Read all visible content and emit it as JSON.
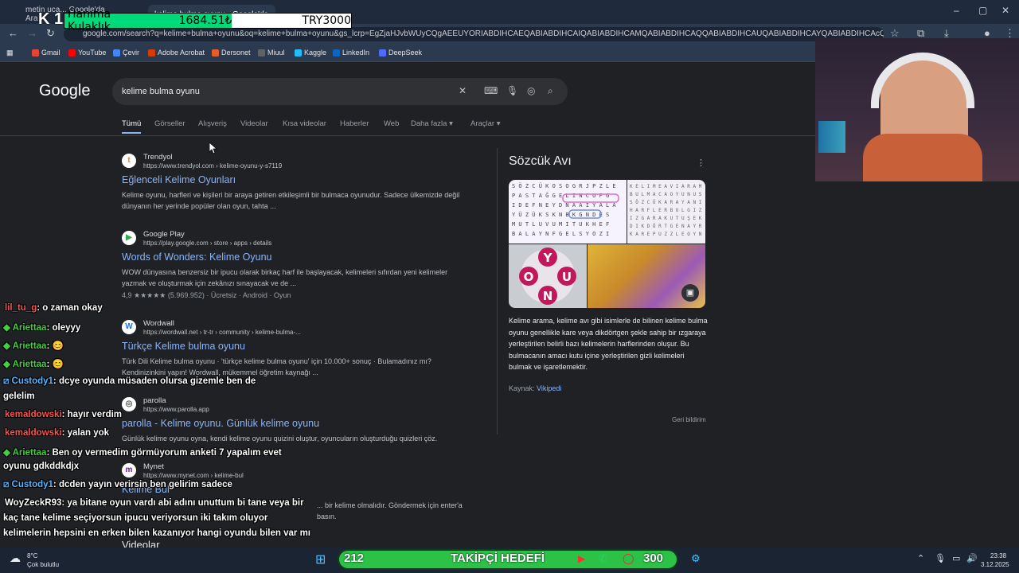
{
  "overlay": {
    "price_item": "Hanıma Kulaklık",
    "price_value": "1684.51₺",
    "price_target": "TRY3000",
    "logo_number": "12"
  },
  "browser": {
    "tabs": [
      {
        "label": "metin uca... Google'da Ara"
      },
      {
        "label": "kelime bulma oyunu - Google'da"
      }
    ],
    "url": "google.com/search?q=kelime+bulma+oyunu&oq=kelime+bulma+oyunu&gs_lcrp=EgZjaHJvbWUyCQgAEEUYORIABDIHCAEQABIABDIHCAIQABIABDIHCAMQABIABDIHCAQQABIABDIHCAUQABIABDIHCAYQABIABDIHCAcQABIABDIHCAgQABIABDIHCAkQABIABNIBCDI4ODVqMGo3qAIAsAIA",
    "bookmarks": [
      {
        "label": "Gmail",
        "color": "#ea4335"
      },
      {
        "label": "YouTube",
        "color": "#ff0000"
      },
      {
        "label": "Çevir",
        "color": "#4285f4"
      },
      {
        "label": "Adobe Acrobat",
        "color": "#d83b01"
      },
      {
        "label": "Dersonet",
        "color": "#e85c2b"
      },
      {
        "label": "Miuul",
        "color": "#5f6368"
      },
      {
        "label": "Kaggle",
        "color": "#20beff"
      },
      {
        "label": "LinkedIn",
        "color": "#0a66c2"
      },
      {
        "label": "DeepSeek",
        "color": "#4d6bfe"
      }
    ]
  },
  "google": {
    "logo": "Google",
    "query": "kelime bulma oyunu",
    "tabs": [
      "Tümü",
      "Görseller",
      "Alışveriş",
      "Videolar",
      "Kısa videolar",
      "Haberler",
      "Web",
      "Daha fazla",
      "Araçlar"
    ],
    "results": [
      {
        "site": "Trendyol",
        "url": "https://www.trendyol.com › kelime-oyunu-y-s7119",
        "title": "Eğlenceli Kelime Oyunları",
        "snippet": "Kelime oyunu, harfleri ve kişileri bir araya getiren etkileşimli bir bulmaca oyunudur. Sadece ülkemizde değil dünyanın her yerinde popüler olan oyun, tahta ..."
      },
      {
        "site": "Google Play",
        "url": "https://play.google.com › store › apps › details",
        "title": "Words of Wonders: Kelime Oyunu",
        "snippet": "WOW dünyasına benzersiz bir ipucu olarak birkaç harf ile başlayacak, kelimeleri sıfırdan yeni kelimeler yazmak ve oluşturmak için zekânızı sınayacak ve de ...",
        "meta": "4,9 ★★★★★ (5.969.952) · Ücretsiz · Android · Oyun"
      },
      {
        "site": "Wordwall",
        "url": "https://wordwall.net › tr-tr › community › kelime-bulma-...",
        "title": "Türkçe Kelime bulma oyunu",
        "snippet": "Türk Dili Kelime bulma oyunu · 'türkçe kelime bulma oyunu' için 10.000+ sonuç · Bulamadınız mı? Kendinizinkini yapın! Wordwall, mükemmel öğretim kaynağı ..."
      },
      {
        "site": "parolla",
        "url": "https://www.parolla.app",
        "title": "parolla - Kelime oyunu. Günlük kelime oyunu",
        "snippet": "Günlük kelime oyunu oyna, kendi kelime oyunu quizini oluştur, oyuncuların oluşturduğu quizleri çöz."
      },
      {
        "site": "Mynet",
        "url": "https://www.mynet.com › kelime-bul",
        "title": "Kelime Bul",
        "snippet": "... bir kelime olmalıdır. Göndermek için enter'a basın."
      }
    ],
    "videos_heading": "Videolar"
  },
  "knowledge_panel": {
    "title": "Sözcük Avı",
    "letters_o": "O",
    "letters_y": "Y",
    "letters_u": "U",
    "letters_n": "N",
    "description": "Kelime arama, kelime avı gibi isimlerle de bilinen kelime bulma oyunu genellikle kare veya dikdörtgen şekle sahip bir ızgaraya yerleştirilen belirli bazı kelimelerin harflerinden oluşur. Bu bulmacanın amacı kutu içine yerleştirilen gizli kelimeleri bulmak ve işaretlemektir.",
    "source_label": "Kaynak:",
    "source_link": "Vikipedi",
    "feedback": "Geri bildirim"
  },
  "chat": [
    {
      "user": "lil_tu_g",
      "text": ": o zaman okay",
      "color": "red"
    },
    {
      "user": "Ariettaa",
      "text": ": oleyyy",
      "color": "green"
    },
    {
      "user": "Ariettaa",
      "text": ": 😊",
      "color": "green"
    },
    {
      "user": "Ariettaa",
      "text": ": 😊",
      "color": "green"
    },
    {
      "user": "Custody1",
      "text": ": dcye oyunda müsaden olursa gizemle ben de",
      "color": "blue"
    },
    {
      "user": "",
      "text": "gelelim",
      "color": "white"
    },
    {
      "user": "kemaldowski",
      "text": ": hayır verdim",
      "color": "red"
    },
    {
      "user": "kemaldowski",
      "text": ": yalan yok",
      "color": "red"
    },
    {
      "user": "Ariettaa",
      "text": ": Ben oy vermedim görmüyorum anketi 7 yapalım evet",
      "color": "green"
    },
    {
      "user": "",
      "text": "oyunu gdkddkdjx",
      "color": "white"
    },
    {
      "user": "Custody1",
      "text": ": dcden yayın verirsin ben gelirim sadece",
      "color": "blue"
    },
    {
      "user": "WoyZeckR93",
      "text": ": ya bitane oyun vardı abi adını unuttum bi tane veya bir",
      "color": "white"
    },
    {
      "user": "",
      "text": "kaç tane kelime seçiyorsun ipucu veriyorsun iki takım oluyor",
      "color": "white"
    },
    {
      "user": "",
      "text": "kelimelerin hepsini en erken bilen kazanıyor hangi oyundu bilen var mı",
      "color": "white"
    }
  ],
  "taskbar": {
    "weather_temp": "8°C",
    "weather_desc": "Çok bulutlu",
    "goal_current": "212",
    "goal_label": "TAKİPÇİ HEDEFİ",
    "goal_target": "300",
    "time": "23:38",
    "date": "3.12.2025"
  }
}
